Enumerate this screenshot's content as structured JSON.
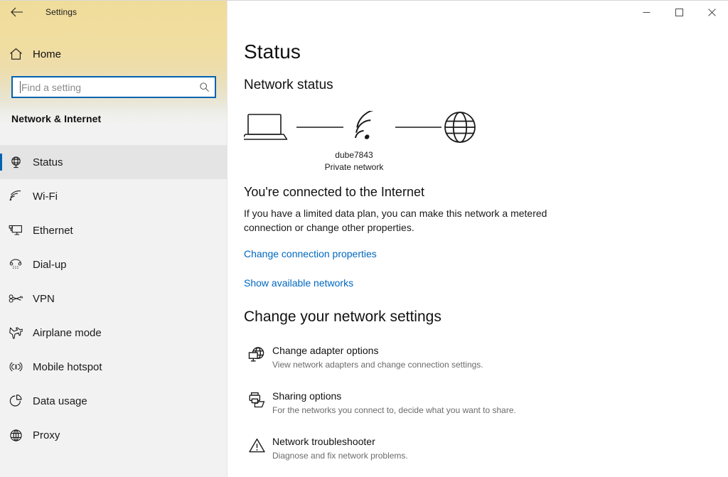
{
  "window": {
    "app_title": "Settings",
    "back_icon": "back-arrow-icon",
    "controls": [
      {
        "name": "minimize",
        "label": "Minimize"
      },
      {
        "name": "maximize",
        "label": "Maximize"
      },
      {
        "name": "close",
        "label": "Close"
      }
    ]
  },
  "sidebar": {
    "home_label": "Home",
    "home_icon": "home-icon",
    "search": {
      "placeholder": "Find a setting",
      "value": "",
      "icon": "search-icon"
    },
    "group_title": "Network & Internet",
    "items": [
      {
        "label": "Status",
        "icon": "network-status-icon",
        "selected": true
      },
      {
        "label": "Wi-Fi",
        "icon": "wifi-icon",
        "selected": false
      },
      {
        "label": "Ethernet",
        "icon": "ethernet-icon",
        "selected": false
      },
      {
        "label": "Dial-up",
        "icon": "dialup-phone-icon",
        "selected": false
      },
      {
        "label": "VPN",
        "icon": "vpn-key-icon",
        "selected": false
      },
      {
        "label": "Airplane mode",
        "icon": "airplane-icon",
        "selected": false
      },
      {
        "label": "Mobile hotspot",
        "icon": "hotspot-icon",
        "selected": false
      },
      {
        "label": "Data usage",
        "icon": "pie-chart-icon",
        "selected": false
      },
      {
        "label": "Proxy",
        "icon": "globe-icon",
        "selected": false
      }
    ]
  },
  "main": {
    "page_title": "Status",
    "network_status_heading": "Network status",
    "diagram": {
      "device_icon": "laptop-icon",
      "link_icon": "wifi-signal-icon",
      "internet_icon": "globe-icon",
      "network_name": "dube7843",
      "network_type": "Private network"
    },
    "connection_heading": "You're connected to the Internet",
    "connection_description": "If you have a limited data plan, you can make this network a metered connection or change other properties.",
    "links": [
      {
        "label": "Change connection properties"
      },
      {
        "label": "Show available networks"
      }
    ],
    "change_settings_heading": "Change your network settings",
    "settings_items": [
      {
        "icon": "adapter-globe-icon",
        "title": "Change adapter options",
        "subtitle": "View network adapters and change connection settings."
      },
      {
        "icon": "sharing-printer-folder-icon",
        "title": "Sharing options",
        "subtitle": "For the networks you connect to, decide what you want to share."
      },
      {
        "icon": "warning-triangle-icon",
        "title": "Network troubleshooter",
        "subtitle": "Diagnose and fix network problems."
      }
    ]
  },
  "colors": {
    "accent": "#0063b1",
    "link": "#0067c0",
    "sidebar_bg": "#f2f2f2",
    "wash_top": "#f0dc9a"
  }
}
